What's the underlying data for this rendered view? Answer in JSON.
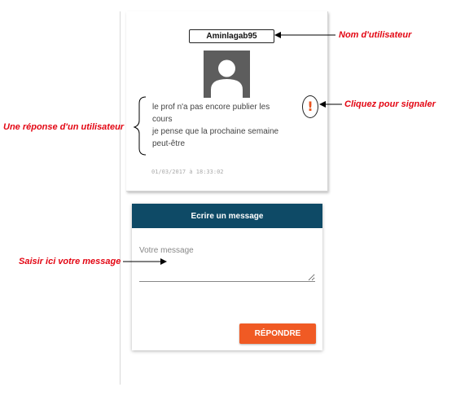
{
  "comment": {
    "username": "Aminlagab95",
    "lines": [
      "le prof n'a pas encore publier les",
      "cours",
      "je pense que la prochaine semaine",
      "peut-être"
    ],
    "timestamp": "01/03/2017 à 18:33:02",
    "report_icon": "!"
  },
  "message_form": {
    "header": "Ecrire un message",
    "placeholder": "Votre message",
    "reply_label": "RÉPONDRE"
  },
  "annotations": {
    "username": "Nom d'utilisateur",
    "report": "Cliquez pour signaler",
    "response": "Une réponse d'un utilisateur",
    "input": "Saisir ici votre message"
  },
  "colors": {
    "header_bg": "#0e4a66",
    "reply_button": "#f05a24",
    "report_icon": "#e8531e",
    "annotation_text": "#e30613"
  }
}
